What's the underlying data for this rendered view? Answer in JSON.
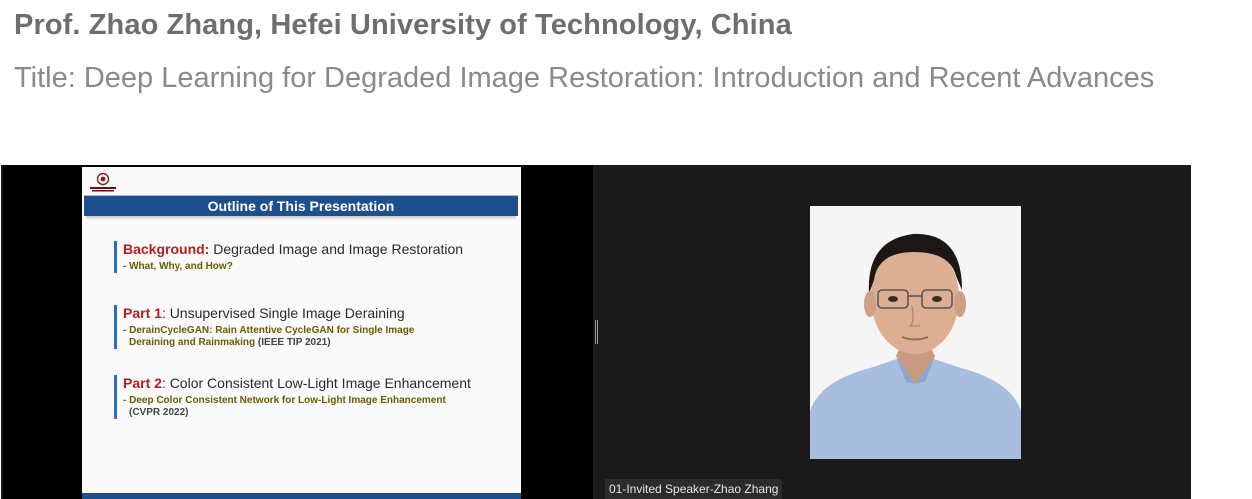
{
  "speaker": "Prof. Zhao Zhang, Hefei University of Technology, China",
  "talk_title": "Title: Deep Learning for Degraded Image Restoration: Introduction and Recent Advances",
  "slide": {
    "header": "Outline of This Presentation",
    "items": [
      {
        "label": "Background:",
        "text": " Degraded Image and Image Restoration",
        "sub_lines": [
          "- What, Why, and How?"
        ],
        "sub_suffix": ""
      },
      {
        "label": "Part 1",
        "text": ": Unsupervised Single Image Deraining",
        "sub_lines": [
          "- DerainCycleGAN: Rain Attentive CycleGAN for Single Image",
          "Deraining and Rainmaking"
        ],
        "sub_suffix": " (IEEE TIP 2021)"
      },
      {
        "label": "Part 2",
        "text": ": Color Consistent Low-Light Image Enhancement",
        "sub_lines": [
          "- Deep Color Consistent Network for Low-Light Image Enhancement",
          "(CVPR 2022)"
        ],
        "sub_suffix": ""
      }
    ]
  },
  "participant": {
    "name": "01-Invited Speaker-Zhao Zhang"
  },
  "colors": {
    "slide_header_bg": "#1f4e8c",
    "label_red": "#b11e1e",
    "sub_text": "#6b5c00"
  }
}
